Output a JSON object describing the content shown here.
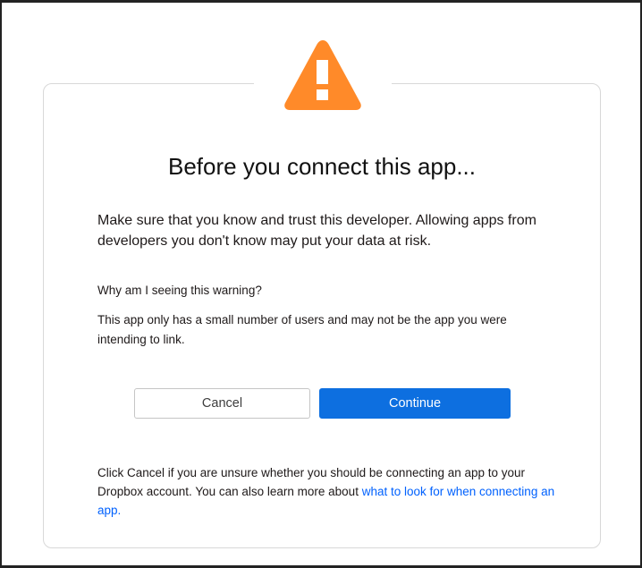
{
  "dialog": {
    "title": "Before you connect this app...",
    "intro": "Make sure that you know and trust this developer. Allowing apps from developers you don't know may put your data at risk.",
    "why_question": "Why am I seeing this warning?",
    "why_answer": "This app only has a small number of users and may not be the app you were intending to link.",
    "cancel_label": "Cancel",
    "continue_label": "Continue",
    "footer_text": "Click Cancel if you are unsure whether you should be connecting an app to your Dropbox account. You can also learn more about ",
    "footer_link": "what to look for when connecting an app.",
    "warning_icon": "warning-triangle-icon",
    "colors": {
      "warning": "#ff8a29",
      "primary": "#0d6fe0",
      "link": "#0061fe"
    }
  }
}
